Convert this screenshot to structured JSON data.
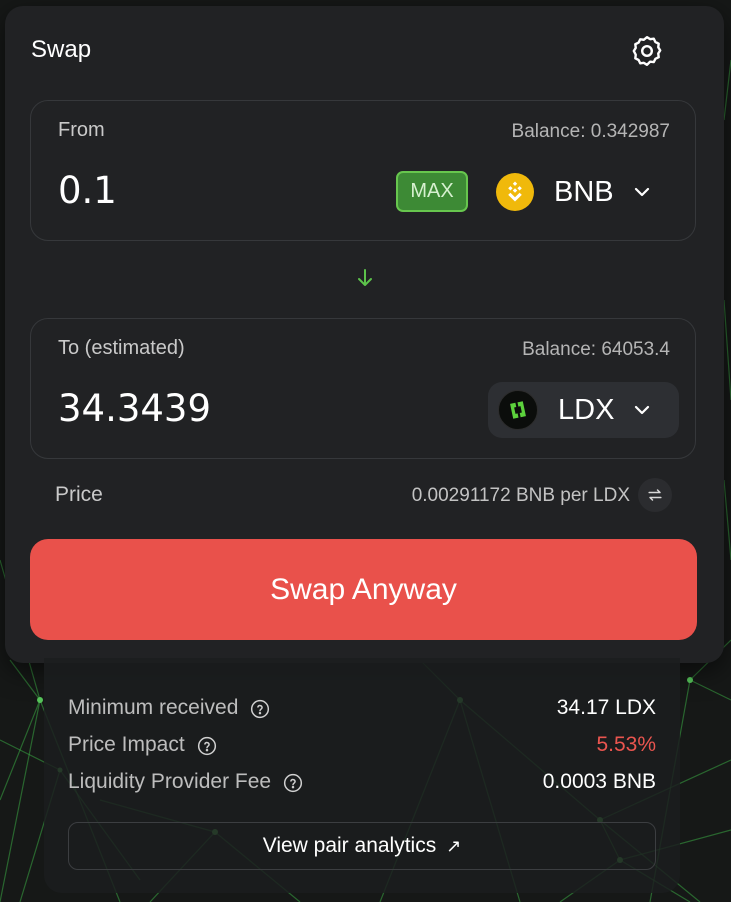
{
  "colors": {
    "accent_green": "#67c64e",
    "danger_red": "#e9514b",
    "card_bg": "#212224"
  },
  "header": {
    "title": "Swap",
    "settings_icon": "gear-icon"
  },
  "from": {
    "label": "From",
    "balance": "Balance: 0.342987",
    "amount": "0.1",
    "max_label": "MAX",
    "token": "BNB",
    "token_icon": "bnb-token-icon"
  },
  "switch_icon": "arrow-down-icon",
  "to": {
    "label": "To (estimated)",
    "balance": "Balance: 64053.4",
    "amount": "34.3439",
    "token": "LDX",
    "token_icon": "ldx-token-icon"
  },
  "price": {
    "label": "Price",
    "value": "0.00291172 BNB per LDX",
    "invert_icon": "swap-rate-icon"
  },
  "swap_button": "Swap Anyway",
  "details": {
    "rows": [
      {
        "label": "Minimum received",
        "value": "34.17 LDX"
      },
      {
        "label": "Price Impact",
        "value": "5.53%"
      },
      {
        "label": "Liquidity Provider Fee",
        "value": "0.0003 BNB"
      }
    ],
    "analytics_link": "View pair analytics",
    "analytics_icon": "external-link-icon"
  }
}
